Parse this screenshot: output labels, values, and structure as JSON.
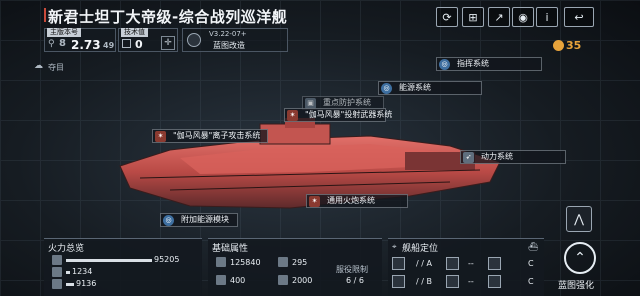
{
  "title": "新君士坦丁大帝级-综合战列巡洋舰",
  "topbar_buttons": [
    {
      "name": "refresh-icon",
      "glyph": "⟳"
    },
    {
      "name": "grid-icon",
      "glyph": "⊞"
    },
    {
      "name": "share-icon",
      "glyph": "↗"
    },
    {
      "name": "view-icon",
      "glyph": "◉"
    },
    {
      "name": "info-icon",
      "glyph": "i"
    },
    {
      "name": "back-icon",
      "glyph": "↩"
    }
  ],
  "info": {
    "main_label": "主版本号",
    "main_level": "8",
    "main_value": "2.73",
    "main_small": "49",
    "tech_label": "技术值",
    "tech_value": "0",
    "version_code": "V3.22-07+",
    "version_name": "蓝图改造"
  },
  "resource": {
    "value": "35",
    "color": "#e7a33b"
  },
  "weather": "夺目",
  "systems": [
    {
      "key": "command",
      "text": "指挥系统",
      "type": "blue"
    },
    {
      "key": "energy",
      "text": "能源系统",
      "type": "blue"
    },
    {
      "key": "armor",
      "text": "重点防护系统",
      "type": "plain"
    },
    {
      "key": "launcher",
      "text": "\"伽马风暴\"投射武器系统",
      "type": "weapon"
    },
    {
      "key": "ion",
      "text": "\"伽马风暴\"离子攻击系统",
      "type": "weapon"
    },
    {
      "key": "power",
      "text": "动力系统",
      "type": "plain"
    },
    {
      "key": "cannon",
      "text": "通用火炮系统",
      "type": "weapon"
    },
    {
      "key": "addon",
      "text": "附加能源模块",
      "type": "blue"
    }
  ],
  "firepower": {
    "title": "火力总览",
    "rows": [
      {
        "icon": "weapon-a",
        "value": "95205"
      },
      {
        "icon": "weapon-b",
        "value": "1234"
      },
      {
        "icon": "weapon-c",
        "value": "9136"
      }
    ]
  },
  "attributes": {
    "title": "基础属性",
    "hp": "125840",
    "armor": "295",
    "shield": "400",
    "speed": "2000",
    "limit_label": "服役限制",
    "limit_value": "6 / 6"
  },
  "positioning": {
    "title": "舰船定位",
    "cells": [
      {
        "value": "/ / A"
      },
      {
        "value": "--"
      },
      {
        "value": "C"
      },
      {
        "value": "/ / B"
      },
      {
        "value": "--"
      },
      {
        "value": "C"
      }
    ]
  },
  "enhance": {
    "label": "蓝图强化"
  }
}
